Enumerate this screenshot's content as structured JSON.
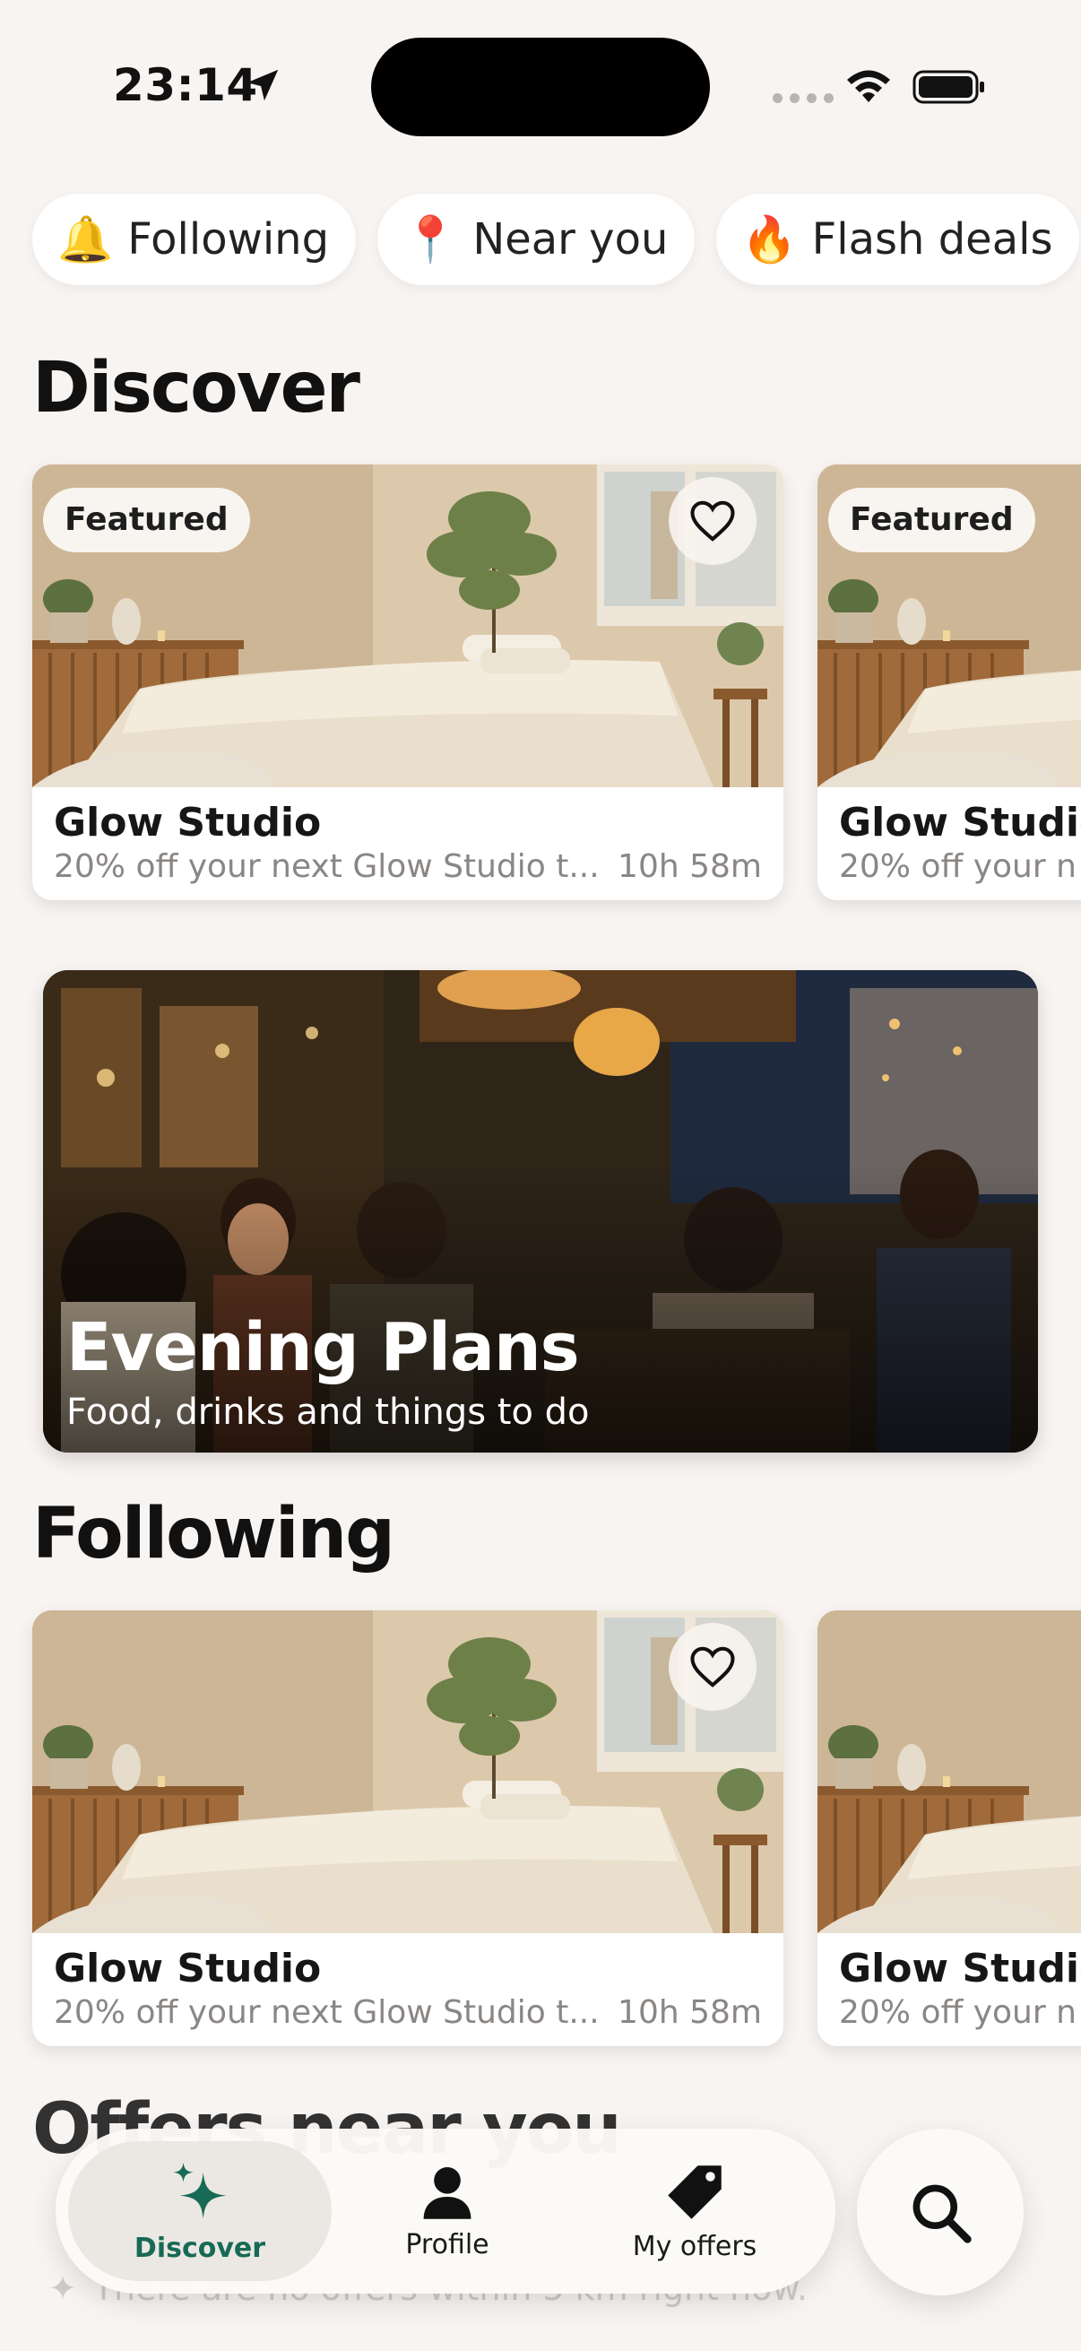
{
  "status_bar": {
    "time": "23:14"
  },
  "chips": [
    {
      "emoji": "🔔",
      "label": "Following"
    },
    {
      "emoji": "📍",
      "label": "Near you"
    },
    {
      "emoji": "🔥",
      "label": "Flash deals"
    }
  ],
  "sections": {
    "discover": "Discover",
    "following": "Following",
    "offers_near_you": "Offers near you"
  },
  "discover_cards": [
    {
      "badge": "Featured",
      "name": "Glow Studio",
      "desc": "20% off your next Glow Studio t...",
      "timer": "10h 58m"
    },
    {
      "badge": "Featured",
      "name": "Glow Studio",
      "desc": "20% off your n"
    }
  ],
  "banner": {
    "title": "Evening Plans",
    "subtitle": "Food, drinks and things to do"
  },
  "following_cards": [
    {
      "name": "Glow Studio",
      "desc": "20% off your next Glow Studio t...",
      "timer": "10h 58m"
    },
    {
      "name": "Glow Studio",
      "desc": "20% off your n"
    }
  ],
  "empty_note": "There are no offers within 5 km right now.",
  "tab_bar": {
    "tabs": [
      {
        "label": "Discover",
        "icon": "sparkles-icon",
        "active": true
      },
      {
        "label": "Profile",
        "icon": "person-icon"
      },
      {
        "label": "My offers",
        "icon": "tag-icon"
      }
    ],
    "search_icon": "magnifier-icon"
  },
  "colors": {
    "accent": "#176a55",
    "background": "#f8f4f2"
  }
}
